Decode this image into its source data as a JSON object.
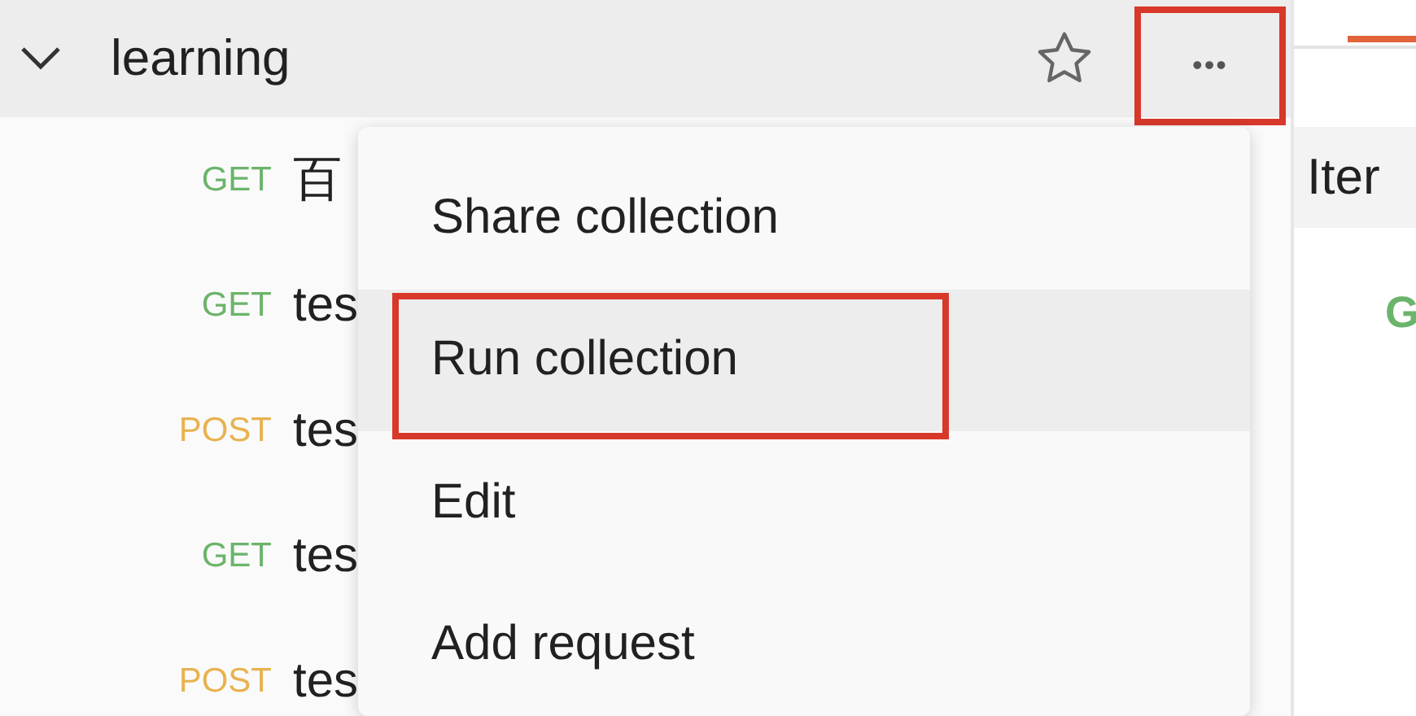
{
  "collection": {
    "name": "learning",
    "expanded": true,
    "more_button": {
      "icon": "•••",
      "highlighted": true
    }
  },
  "requests": [
    {
      "method": "GET",
      "name": "百"
    },
    {
      "method": "GET",
      "name": "tes"
    },
    {
      "method": "POST",
      "name": "tes"
    },
    {
      "method": "GET",
      "name": "tes"
    },
    {
      "method": "POST",
      "name": "tes"
    }
  ],
  "context_menu": [
    {
      "label": "Share collection",
      "selected": false,
      "highlighted": false
    },
    {
      "label": "Run collection",
      "selected": true,
      "highlighted": true
    },
    {
      "label": "Edit",
      "selected": false,
      "highlighted": false
    },
    {
      "label": "Add request",
      "selected": false,
      "highlighted": false
    }
  ],
  "right_panel": {
    "label": "Iter",
    "method": "G"
  }
}
